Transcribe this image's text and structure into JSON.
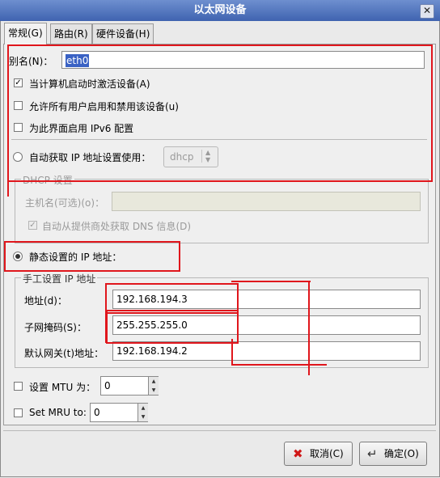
{
  "window": {
    "title": "以太网设备",
    "close_glyph": "✕"
  },
  "tabs": [
    {
      "label": "常规(G)",
      "active": true
    },
    {
      "label": "路由(R)",
      "active": false
    },
    {
      "label": "硬件设备(H)",
      "active": false
    }
  ],
  "general": {
    "alias_label": "别名(N)：",
    "alias_value": "eth0",
    "checkboxes": [
      {
        "label": "当计算机启动时激活设备(A)",
        "checked": true
      },
      {
        "label": "允许所有用户启用和禁用该设备(u)",
        "checked": false
      },
      {
        "label": "为此界面启用 IPv6 配置",
        "checked": false
      }
    ],
    "auto_ip_label": "自动获取 IP 地址设置使用：",
    "auto_ip_method": "dhcp",
    "dhcp": {
      "group_title": "DHCP 设置",
      "hostname_label": "主机名(可选)(o)：",
      "hostname_value": "",
      "dns_label": "自动从提供商处获取 DNS 信息(D)",
      "dns_checked": true
    },
    "static_ip_label": "静态设置的 IP 地址：",
    "manual": {
      "group_title": "手工设置 IP 地址",
      "address_label": "地址(d)：",
      "address_value": "192.168.194.3",
      "netmask_label": "子网掩码(S)：",
      "netmask_value": "255.255.255.0",
      "gateway_label": "默认网关(t)地址：",
      "gateway_value": "192.168.194.2"
    },
    "mtu_label": "设置 MTU 为：",
    "mtu_value": "0",
    "mru_label": "Set MRU to:",
    "mru_value": "0"
  },
  "buttons": {
    "cancel": {
      "label": "取消(C)",
      "icon": "cancel-x-icon",
      "icon_color": "#d01818"
    },
    "ok": {
      "label": "确定(O)",
      "icon": "enter-arrow-icon"
    }
  },
  "annotation_color": "#e0161c"
}
